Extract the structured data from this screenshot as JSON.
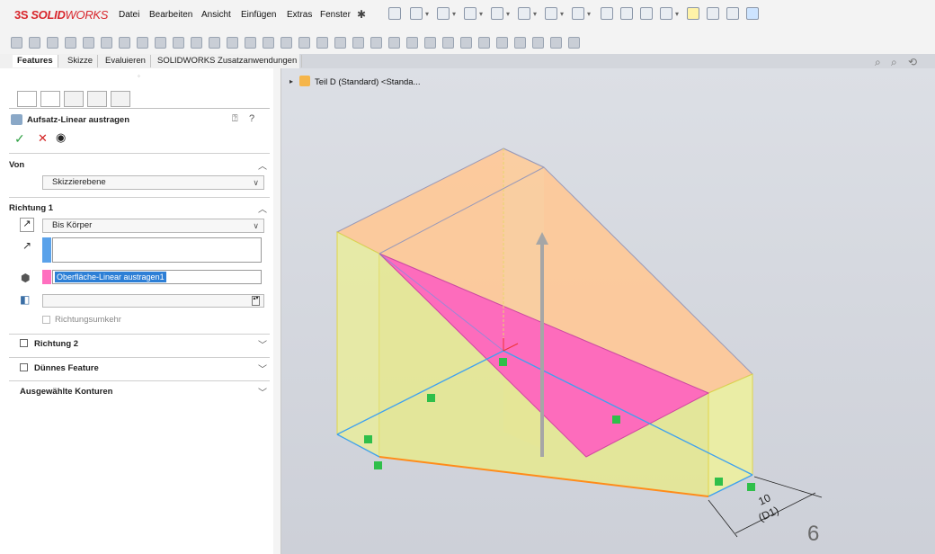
{
  "app": {
    "logo_brand": "SOLID",
    "logo_suffix": "WORKS",
    "logo_mark": "3S"
  },
  "menu": [
    "Datei",
    "Bearbeiten",
    "Ansicht",
    "Einfügen",
    "Extras",
    "Fenster"
  ],
  "tabs": [
    "Features",
    "Skizze",
    "Evaluieren",
    "SOLIDWORKS Zusatzanwendungen"
  ],
  "feature": {
    "title": "Aufsatz-Linear austragen"
  },
  "von": {
    "label": "Von",
    "value": "Skizzierebene"
  },
  "richtung1": {
    "label": "Richtung 1",
    "end_condition": "Bis Körper",
    "body": "Oberfläche-Linear austragen1",
    "reverse_label": "Richtungsumkehr"
  },
  "richtung2": {
    "label": "Richtung 2"
  },
  "thin": {
    "label": "Dünnes Feature"
  },
  "contours": {
    "label": "Ausgewählte Konturen"
  },
  "tree": {
    "label": "Teil D (Standard) <Standa..."
  },
  "dimension": {
    "value": "10",
    "name": "(D1)"
  },
  "page_number": "6",
  "colors": {
    "accent": "#d8262c",
    "selection": "#2d7fd6",
    "body_pink": "#ff66c4",
    "body_orange": "#ffc68f",
    "body_yellow": "#e9ec9c"
  }
}
